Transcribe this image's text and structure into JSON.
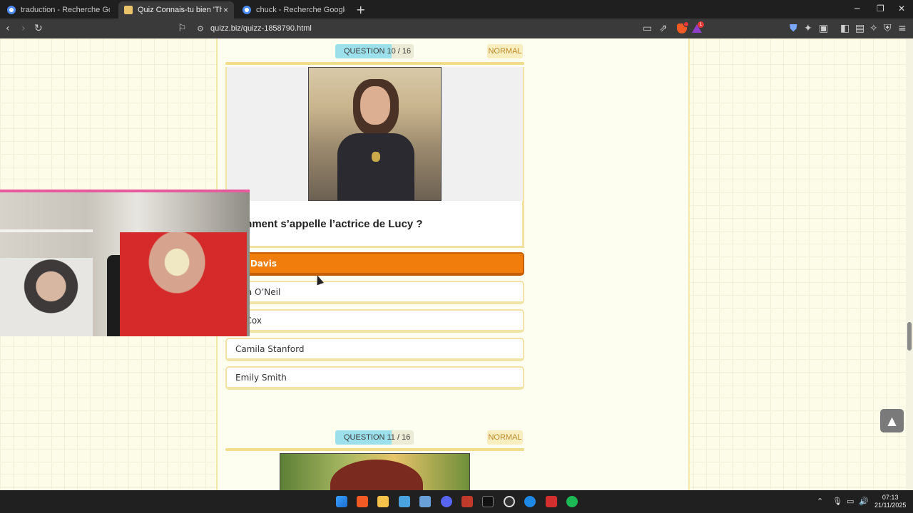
{
  "browser": {
    "tabs": [
      {
        "title": "traduction - Recherche Google",
        "active": false
      },
      {
        "title": "Quiz Connais-tu bien 'The Rooki",
        "active": true
      },
      {
        "title": "chuck - Recherche Google",
        "active": false
      }
    ],
    "close_tab_glyph": "×",
    "new_tab_glyph": "+",
    "url": "quizz.biz/quizz-1858790.html",
    "rewards_badge": "1"
  },
  "quiz": {
    "question10": {
      "label": "QUESTION 10 / 16",
      "difficulty": "NORMAL",
      "text": "mment s’appelle l’actrice de Lucy ?",
      "answers": [
        {
          "text": "na Davis",
          "selected": true
        },
        {
          "text": "issa O’Neil",
          "selected": false
        },
        {
          "text": "ia Cox",
          "selected": false
        },
        {
          "text": "Camila Stanford",
          "selected": false
        },
        {
          "text": "Emily Smith",
          "selected": false
        }
      ]
    },
    "question11": {
      "label": "QUESTION 11 / 16",
      "difficulty": "NORMAL"
    }
  },
  "colors": {
    "selected_answer": "#f07d0c",
    "question_badge": "#9be0eb",
    "difficulty_badge": "#f8eec0",
    "webcam_border": "#e85aa0"
  },
  "taskbar": {
    "time": "07:13",
    "date": "21/11/2025"
  }
}
